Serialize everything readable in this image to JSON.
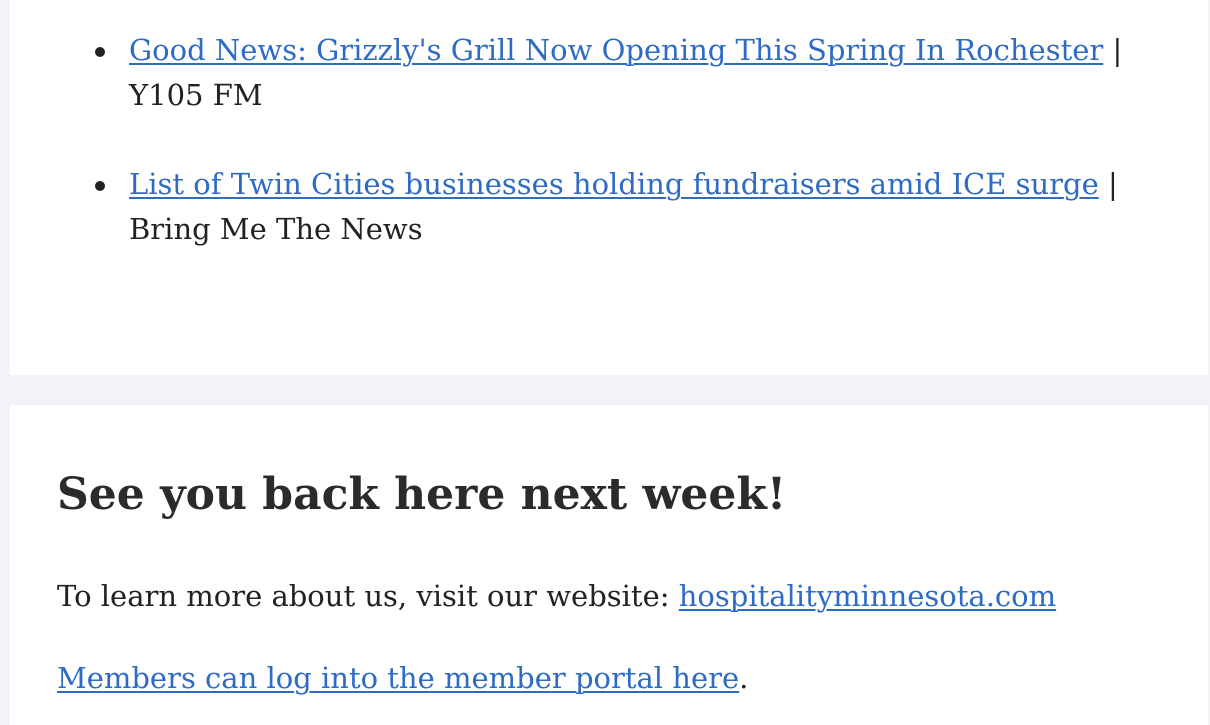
{
  "news": {
    "items": [
      {
        "title": "Good News: Grizzly's Grill Now Opening This Spring In Rochester",
        "separator": "|",
        "source": "Y105 FM"
      },
      {
        "title": "List of Twin Cities businesses holding fundraisers amid ICE surge",
        "separator": "|",
        "source": "Bring Me The News"
      }
    ]
  },
  "closing": {
    "heading": "See you back here next week!",
    "learn_more_text": "To learn more about us, visit our website: ",
    "website_link": "hospitalityminnesota.com",
    "portal_link": "Members can log into the member portal here",
    "portal_suffix": "."
  },
  "colors": {
    "link": "#2d6bc4",
    "page_background": "#f2f3f7",
    "card_background": "#ffffff",
    "text": "#222222"
  }
}
